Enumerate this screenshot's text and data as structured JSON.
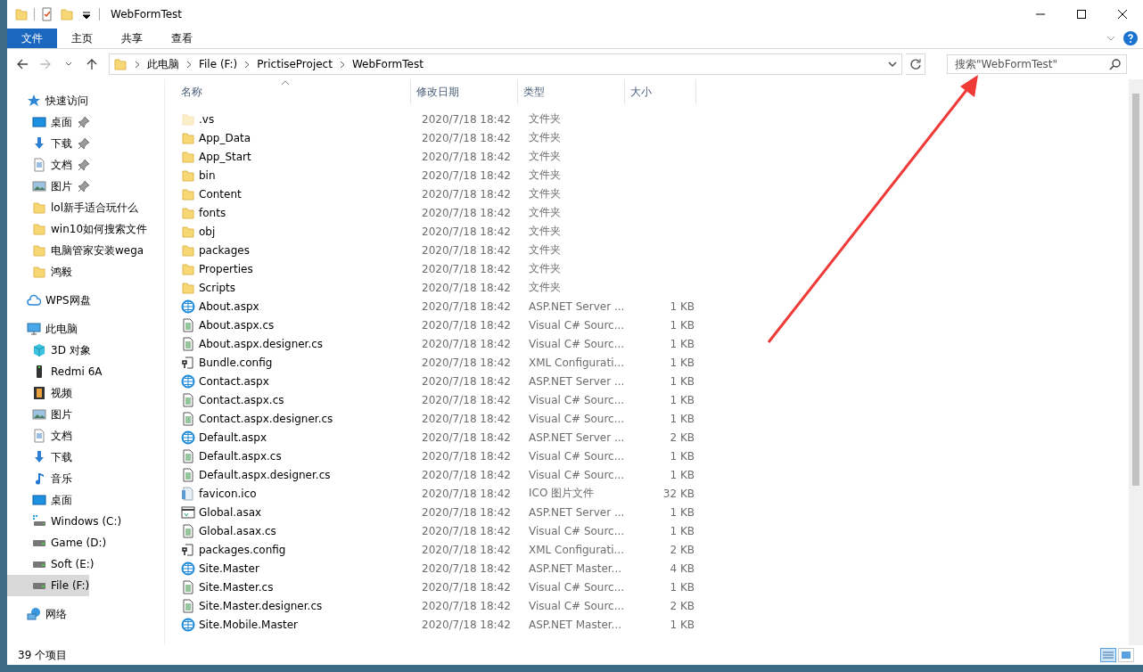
{
  "window": {
    "title": "WebFormTest"
  },
  "ribbon_tabs": [
    {
      "label": "文件",
      "selected": true
    },
    {
      "label": "主页",
      "selected": false
    },
    {
      "label": "共享",
      "selected": false
    },
    {
      "label": "查看",
      "selected": false
    }
  ],
  "address_bar": {
    "crumbs": [
      "此电脑",
      "File (F:)",
      "PrictiseProject",
      "WebFormTest"
    ]
  },
  "search": {
    "placeholder": "搜索\"WebFormTest\""
  },
  "sidebar": {
    "sections": [
      {
        "label": "快速访问",
        "kind": "star",
        "selected": false,
        "children": [
          {
            "label": "桌面",
            "kind": "desktop",
            "pinned": true,
            "selected": false
          },
          {
            "label": "下载",
            "kind": "download",
            "pinned": true,
            "selected": false
          },
          {
            "label": "文档",
            "kind": "document",
            "pinned": true,
            "selected": false
          },
          {
            "label": "图片",
            "kind": "picture",
            "pinned": true,
            "selected": false
          },
          {
            "label": "lol新手适合玩什么",
            "kind": "folder",
            "pinned": false,
            "selected": false
          },
          {
            "label": "win10如何搜索文件",
            "kind": "folder",
            "pinned": false,
            "selected": false
          },
          {
            "label": "电脑管家安装wega",
            "kind": "folder",
            "pinned": false,
            "selected": false
          },
          {
            "label": "鸿毅",
            "kind": "folder",
            "pinned": false,
            "selected": false
          }
        ]
      },
      {
        "label": "WPS网盘",
        "kind": "cloud",
        "selected": false
      },
      {
        "label": "此电脑",
        "kind": "pc",
        "selected": false,
        "children": [
          {
            "label": "3D 对象",
            "kind": "cube",
            "pinned": false,
            "selected": false
          },
          {
            "label": "Redmi 6A",
            "kind": "phone",
            "pinned": false,
            "selected": false
          },
          {
            "label": "视频",
            "kind": "video",
            "pinned": false,
            "selected": false
          },
          {
            "label": "图片",
            "kind": "picture",
            "pinned": false,
            "selected": false
          },
          {
            "label": "文档",
            "kind": "document",
            "pinned": false,
            "selected": false
          },
          {
            "label": "下载",
            "kind": "download",
            "pinned": false,
            "selected": false
          },
          {
            "label": "音乐",
            "kind": "music",
            "pinned": false,
            "selected": false
          },
          {
            "label": "桌面",
            "kind": "desktop",
            "pinned": false,
            "selected": false
          },
          {
            "label": "Windows (C:)",
            "kind": "windrive",
            "pinned": false,
            "selected": false
          },
          {
            "label": "Game (D:)",
            "kind": "drive",
            "pinned": false,
            "selected": false
          },
          {
            "label": "Soft (E:)",
            "kind": "drive",
            "pinned": false,
            "selected": false
          },
          {
            "label": "File (F:)",
            "kind": "drive",
            "pinned": false,
            "selected": true
          }
        ]
      },
      {
        "label": "网络",
        "kind": "network",
        "selected": false
      }
    ]
  },
  "table": {
    "columns": [
      "名称",
      "修改日期",
      "类型",
      "大小"
    ],
    "rows": [
      {
        "name": ".vs",
        "date": "2020/7/18 18:42",
        "type": "文件夹",
        "kind": "folder",
        "hidden": true
      },
      {
        "name": "App_Data",
        "date": "2020/7/18 18:42",
        "type": "文件夹",
        "kind": "folder",
        "hidden": false
      },
      {
        "name": "App_Start",
        "date": "2020/7/18 18:42",
        "type": "文件夹",
        "kind": "folder",
        "hidden": false
      },
      {
        "name": "bin",
        "date": "2020/7/18 18:42",
        "type": "文件夹",
        "kind": "folder",
        "hidden": false
      },
      {
        "name": "Content",
        "date": "2020/7/18 18:42",
        "type": "文件夹",
        "kind": "folder",
        "hidden": false
      },
      {
        "name": "fonts",
        "date": "2020/7/18 18:42",
        "type": "文件夹",
        "kind": "folder",
        "hidden": false
      },
      {
        "name": "obj",
        "date": "2020/7/18 18:42",
        "type": "文件夹",
        "kind": "folder",
        "hidden": false
      },
      {
        "name": "packages",
        "date": "2020/7/18 18:42",
        "type": "文件夹",
        "kind": "folder",
        "hidden": false
      },
      {
        "name": "Properties",
        "date": "2020/7/18 18:42",
        "type": "文件夹",
        "kind": "folder",
        "hidden": false
      },
      {
        "name": "Scripts",
        "date": "2020/7/18 18:42",
        "type": "文件夹",
        "kind": "folder",
        "hidden": false
      },
      {
        "name": "About.aspx",
        "date": "2020/7/18 18:42",
        "type": "ASP.NET Server ...",
        "size": "1 KB",
        "kind": "web",
        "hidden": false
      },
      {
        "name": "About.aspx.cs",
        "date": "2020/7/18 18:42",
        "type": "Visual C# Sourc...",
        "size": "1 KB",
        "kind": "code",
        "hidden": false
      },
      {
        "name": "About.aspx.designer.cs",
        "date": "2020/7/18 18:42",
        "type": "Visual C# Sourc...",
        "size": "1 KB",
        "kind": "code",
        "hidden": false
      },
      {
        "name": "Bundle.config",
        "date": "2020/7/18 18:42",
        "type": "XML Configurati...",
        "size": "1 KB",
        "kind": "config",
        "hidden": false
      },
      {
        "name": "Contact.aspx",
        "date": "2020/7/18 18:42",
        "type": "ASP.NET Server ...",
        "size": "1 KB",
        "kind": "web",
        "hidden": false
      },
      {
        "name": "Contact.aspx.cs",
        "date": "2020/7/18 18:42",
        "type": "Visual C# Sourc...",
        "size": "1 KB",
        "kind": "code",
        "hidden": false
      },
      {
        "name": "Contact.aspx.designer.cs",
        "date": "2020/7/18 18:42",
        "type": "Visual C# Sourc...",
        "size": "1 KB",
        "kind": "code",
        "hidden": false
      },
      {
        "name": "Default.aspx",
        "date": "2020/7/18 18:42",
        "type": "ASP.NET Server ...",
        "size": "2 KB",
        "kind": "web",
        "hidden": false
      },
      {
        "name": "Default.aspx.cs",
        "date": "2020/7/18 18:42",
        "type": "Visual C# Sourc...",
        "size": "1 KB",
        "kind": "code",
        "hidden": false
      },
      {
        "name": "Default.aspx.designer.cs",
        "date": "2020/7/18 18:42",
        "type": "Visual C# Sourc...",
        "size": "1 KB",
        "kind": "code",
        "hidden": false
      },
      {
        "name": "favicon.ico",
        "date": "2020/7/18 18:42",
        "type": "ICO 图片文件",
        "size": "32 KB",
        "kind": "image",
        "hidden": false
      },
      {
        "name": "Global.asax",
        "date": "2020/7/18 18:42",
        "type": "ASP.NET Server ...",
        "size": "1 KB",
        "kind": "app",
        "hidden": false
      },
      {
        "name": "Global.asax.cs",
        "date": "2020/7/18 18:42",
        "type": "Visual C# Sourc...",
        "size": "1 KB",
        "kind": "code",
        "hidden": false
      },
      {
        "name": "packages.config",
        "date": "2020/7/18 18:42",
        "type": "XML Configurati...",
        "size": "2 KB",
        "kind": "config",
        "hidden": false
      },
      {
        "name": "Site.Master",
        "date": "2020/7/18 18:42",
        "type": "ASP.NET Master...",
        "size": "4 KB",
        "kind": "web",
        "hidden": false
      },
      {
        "name": "Site.Master.cs",
        "date": "2020/7/18 18:42",
        "type": "Visual C# Sourc...",
        "size": "1 KB",
        "kind": "code",
        "hidden": false
      },
      {
        "name": "Site.Master.designer.cs",
        "date": "2020/7/18 18:42",
        "type": "Visual C# Sourc...",
        "size": "2 KB",
        "kind": "code",
        "hidden": false
      },
      {
        "name": "Site.Mobile.Master",
        "date": "2020/7/18 18:42",
        "type": "ASP.NET Master...",
        "size": "1 KB",
        "kind": "web",
        "hidden": false
      }
    ]
  },
  "status_bar": {
    "count": "39 个项目"
  }
}
